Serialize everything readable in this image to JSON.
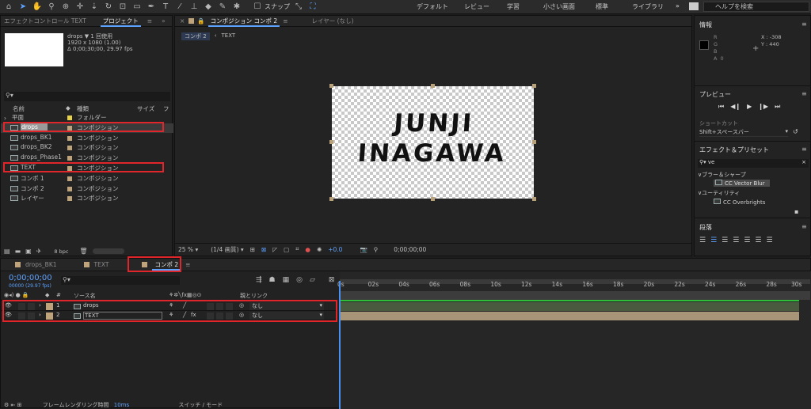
{
  "toolbar": {
    "snap_label": "スナップ",
    "workspaces": [
      "デフォルト",
      "レビュー",
      "学習",
      "小さい画面",
      "標準",
      "ライブラリ"
    ],
    "search_placeholder": "ヘルプを検索"
  },
  "project_panel": {
    "tab_effect_controls": "エフェクトコントロール TEXT",
    "tab_project": "プロジェクト",
    "selected_item": "drops",
    "used_count": "▼ 1 回使用",
    "resolution": "1920 x 1080 (1.00)",
    "duration": "Δ 0;00;30;00, 29.97 fps",
    "col_name": "名前",
    "col_type": "種類",
    "col_size": "サイズ",
    "col_frame": "フ",
    "items": [
      {
        "name": "平面",
        "type": "フォルダー",
        "color": "#e8d24a",
        "folder": true
      },
      {
        "name": "drops",
        "type": "コンポジション",
        "color": "#bfa37a",
        "highlight": true
      },
      {
        "name": "drops_BK1",
        "type": "コンポジション",
        "color": "#bfa37a"
      },
      {
        "name": "drops_BK2",
        "type": "コンポジション",
        "color": "#bfa37a"
      },
      {
        "name": "drops_Phase1",
        "type": "コンポジション",
        "color": "#bfa37a"
      },
      {
        "name": "TEXT",
        "type": "コンポジション",
        "color": "#bfa37a"
      },
      {
        "name": "コンポ 1",
        "type": "コンポジション",
        "color": "#bfa37a"
      },
      {
        "name": "コンポ 2",
        "type": "コンポジション",
        "color": "#bfa37a"
      },
      {
        "name": "レイヤー",
        "type": "コンポジション",
        "color": "#bfa37a"
      }
    ],
    "bpc": "8 bpc"
  },
  "comp_panel": {
    "tab_comp": "コンポジション コンポ 2",
    "tab_layer": "レイヤー (なし)",
    "breadcrumb": [
      "コンポ 2",
      "TEXT"
    ],
    "canvas_text_line1": "JUNJI",
    "canvas_text_line2": "INAGAWA",
    "zoom": "25 %",
    "resolution": "(1/4 画質)",
    "exposure": "+0.0",
    "timecode": "0;00;00;00"
  },
  "info_panel": {
    "title": "情報",
    "r": "R",
    "g": "G",
    "b": "B",
    "a": "A",
    "a_value": "0",
    "x_label": "X : -308",
    "y_label": "Y : 440"
  },
  "preview_panel": {
    "title": "プレビュー",
    "shortcut_label": "ショートカット",
    "shortcut_value": "Shift+スペースバー"
  },
  "effects_panel": {
    "title": "エフェクト＆プリセット",
    "search_value": "ve",
    "group1": "ブラー＆シャープ",
    "item1": "CC Vector Blur",
    "group2": "ユーティリティ",
    "item2": "CC Overbrights"
  },
  "paragraph_panel": {
    "title": "段落"
  },
  "timeline": {
    "tabs": [
      "drops_BK1",
      "TEXT",
      "コンポ 2"
    ],
    "timecode": "0;00;00;00",
    "fps_note": "00000 (29.97 fps)",
    "col_source": "ソース名",
    "col_parent": "親とリンク",
    "col_hash": "#",
    "layers": [
      {
        "num": "1",
        "name": "drops",
        "parent": "なし"
      },
      {
        "num": "2",
        "name": "TEXT",
        "parent": "なし"
      }
    ],
    "ruler": [
      "0s",
      "02s",
      "04s",
      "06s",
      "08s",
      "10s",
      "12s",
      "14s",
      "16s",
      "18s",
      "20s",
      "22s",
      "24s",
      "26s",
      "28s",
      "30s"
    ],
    "footer_left": "フレームレンダリング時間",
    "footer_ms": "10ms",
    "footer_switch": "スイッチ / モード"
  }
}
